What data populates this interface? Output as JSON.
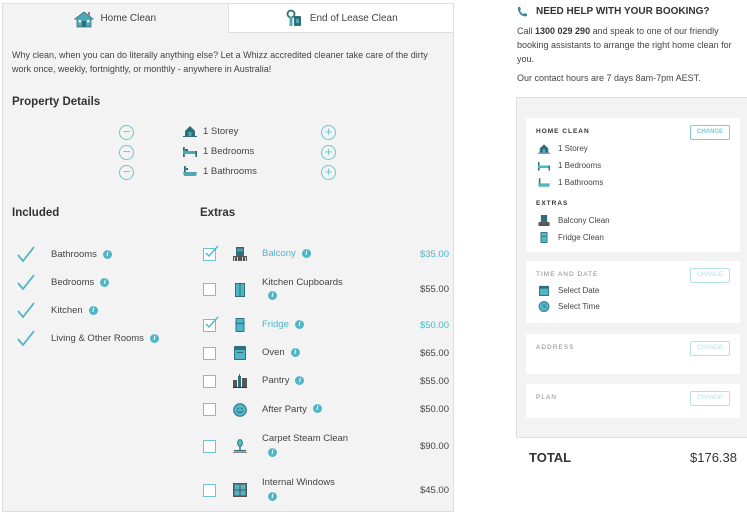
{
  "tabs": [
    {
      "label": "Home Clean",
      "icon": "house-icon",
      "active": true
    },
    {
      "label": "End of Lease Clean",
      "icon": "keys-icon",
      "active": false
    }
  ],
  "intro": "Why clean, when you can do literally anything else? Let a Whizz accredited cleaner take care of the dirty work once, weekly, fortnightly, or monthly - anywhere in Australia!",
  "property": {
    "title": "Property Details",
    "rows": [
      {
        "label": "1 Storey",
        "icon": "storey-icon",
        "value": 1
      },
      {
        "label": "1 Bedrooms",
        "icon": "bed-icon",
        "value": 1
      },
      {
        "label": "1 Bathrooms",
        "icon": "bath-icon",
        "value": 1
      }
    ]
  },
  "included": {
    "title": "Included",
    "items": [
      "Bathrooms",
      "Bedrooms",
      "Kitchen",
      "Living & Other Rooms"
    ]
  },
  "extras": {
    "title": "Extras",
    "items": [
      {
        "label": "Balcony",
        "price": "$35.00",
        "checked": true,
        "icon": "balcony-icon"
      },
      {
        "label": "Kitchen Cupboards",
        "price": "$55.00",
        "checked": false,
        "icon": "cupboard-icon"
      },
      {
        "label": "Fridge",
        "price": "$50.00",
        "checked": true,
        "icon": "fridge-icon"
      },
      {
        "label": "Oven",
        "price": "$65.00",
        "checked": false,
        "icon": "oven-icon"
      },
      {
        "label": "Pantry",
        "price": "$55.00",
        "checked": false,
        "icon": "pantry-icon"
      },
      {
        "label": "After Party",
        "price": "$50.00",
        "checked": false,
        "icon": "smiley-icon"
      },
      {
        "label": "Carpet Steam Clean",
        "price": "$90.00",
        "checked": false,
        "icon": "steam-icon"
      },
      {
        "label": "Internal Windows",
        "price": "$45.00",
        "checked": false,
        "icon": "window-icon"
      }
    ]
  },
  "help": {
    "title": "NEED HELP WITH YOUR BOOKING?",
    "text_prefix": "Call ",
    "phone": "1300 029 290",
    "text_suffix": " and speak to one of our friendly booking assistants to arrange the right home clean for you.",
    "hours": "Our contact hours are 7 days 8am-7pm AEST."
  },
  "summary": {
    "home_clean": {
      "label": "HOME CLEAN",
      "change": "CHANGE",
      "rows": [
        "1 Storey",
        "1 Bedrooms",
        "1 Bathrooms"
      ],
      "extras_label": "EXTRAS",
      "extras": [
        "Balcony Clean",
        "Fridge Clean"
      ]
    },
    "time_date": {
      "label": "TIME AND DATE",
      "change": "CHANGE",
      "date": "Select Date",
      "time": "Select Time"
    },
    "address": {
      "label": "ADDRESS",
      "change": "CHANGE"
    },
    "plan": {
      "label": "PLAN",
      "change": "CHANGE"
    }
  },
  "total": {
    "label": "TOTAL",
    "value": "$176.38"
  },
  "colors": {
    "accent": "#4fb5c7",
    "panel_bg": "#f3f3f3",
    "border": "#e0e0e0"
  }
}
